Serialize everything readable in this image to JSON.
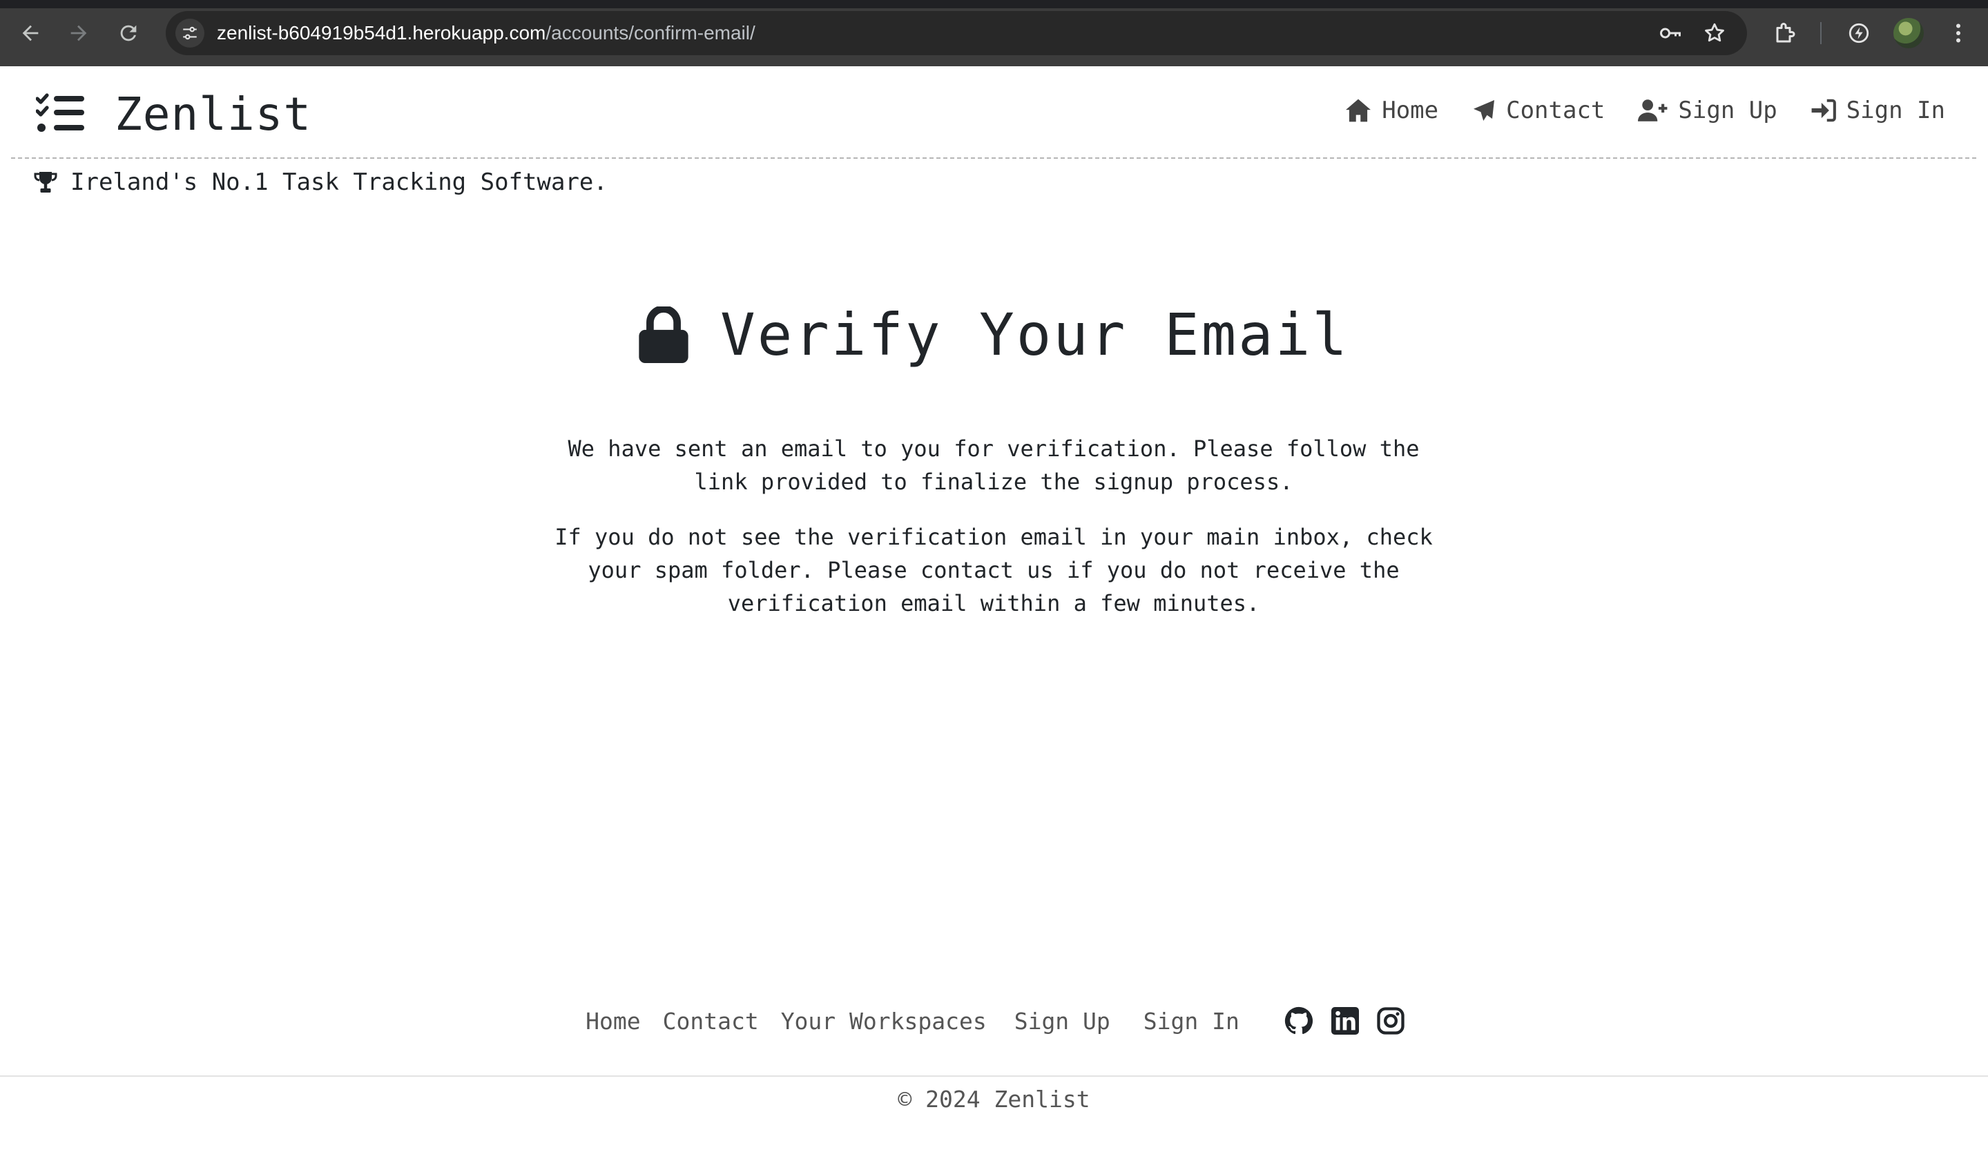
{
  "browser": {
    "url_host": "zenlist-b604919b54d1.herokuapp.com",
    "url_path": "/accounts/confirm-email/",
    "icons": [
      "back-icon",
      "forward-icon",
      "reload-icon",
      "site-info-icon",
      "password-key-icon",
      "bookmark-star-icon",
      "extensions-icon",
      "performance-icon",
      "profile-avatar",
      "menu-dots-icon"
    ]
  },
  "header": {
    "brand": "Zenlist",
    "nav": [
      {
        "label": "Home",
        "icon": "house-icon"
      },
      {
        "label": "Contact",
        "icon": "paper-plane-icon"
      },
      {
        "label": "Sign Up",
        "icon": "user-plus-icon"
      },
      {
        "label": "Sign In",
        "icon": "sign-in-icon"
      }
    ],
    "tagline": "Ireland's No.1 Task Tracking Software."
  },
  "main": {
    "title": "Verify Your Email",
    "paragraph1": "We have sent an email to you for verification. Please follow the link provided to finalize the signup process.",
    "paragraph2": "If you do not see the verification email in your main inbox, check your spam folder. Please contact us if you do not receive the verification email within a few minutes."
  },
  "footer": {
    "links": [
      "Home",
      "Contact",
      "Your Workspaces",
      "Sign Up",
      "Sign In"
    ],
    "socials": [
      "github-icon",
      "linkedin-icon",
      "instagram-icon"
    ],
    "copyright": "© 2024 Zenlist"
  },
  "colors": {
    "chrome_bg": "#3c3c3c",
    "omnibox_bg": "#282828",
    "text": "#212529",
    "muted": "#555555"
  }
}
